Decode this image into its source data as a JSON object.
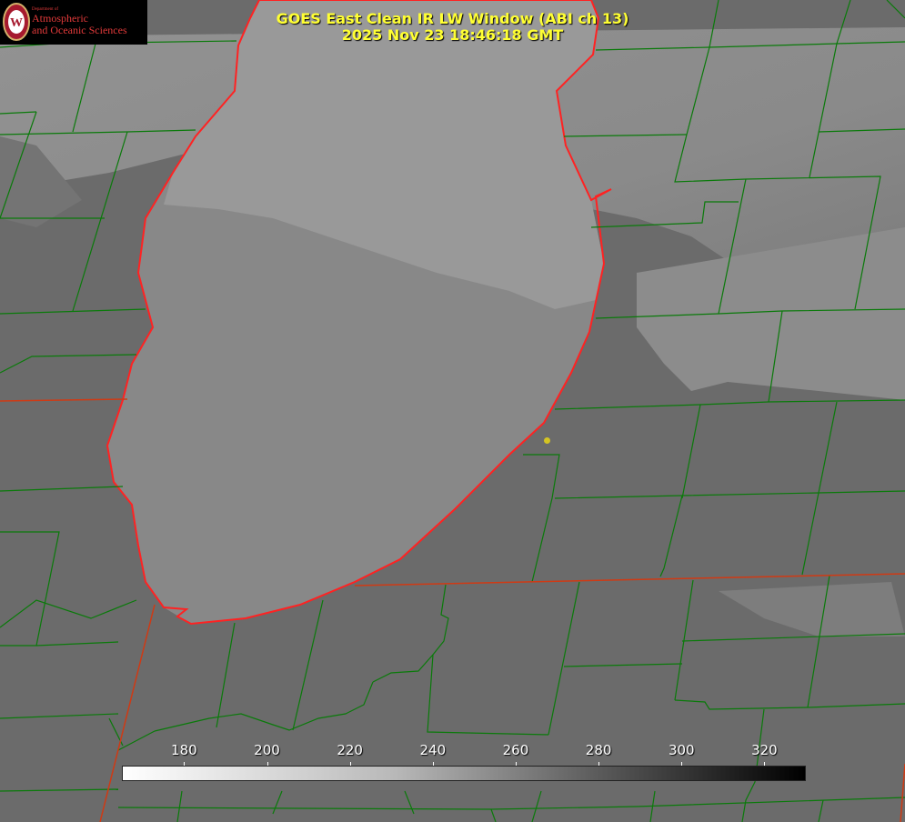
{
  "title": {
    "line1": "GOES East Clean IR LW Window (ABI ch 13)",
    "line2": "2025 Nov 23 18:46:18 GMT"
  },
  "logo": {
    "dept": "Department of",
    "line1": "Atmospheric",
    "line2": "and Oceanic Sciences",
    "seal_letter": "W"
  },
  "colorbar": {
    "ticks": [
      "180",
      "200",
      "220",
      "240",
      "260",
      "280",
      "300",
      "320"
    ],
    "range": [
      165,
      330
    ],
    "colormap": "white-to-black"
  },
  "colors": {
    "county_lines": "#0a7a0a",
    "state_lines": "#d03a14",
    "lake_shore": "#ff2020",
    "title_text": "#ffff33",
    "station": "#d4c422"
  }
}
